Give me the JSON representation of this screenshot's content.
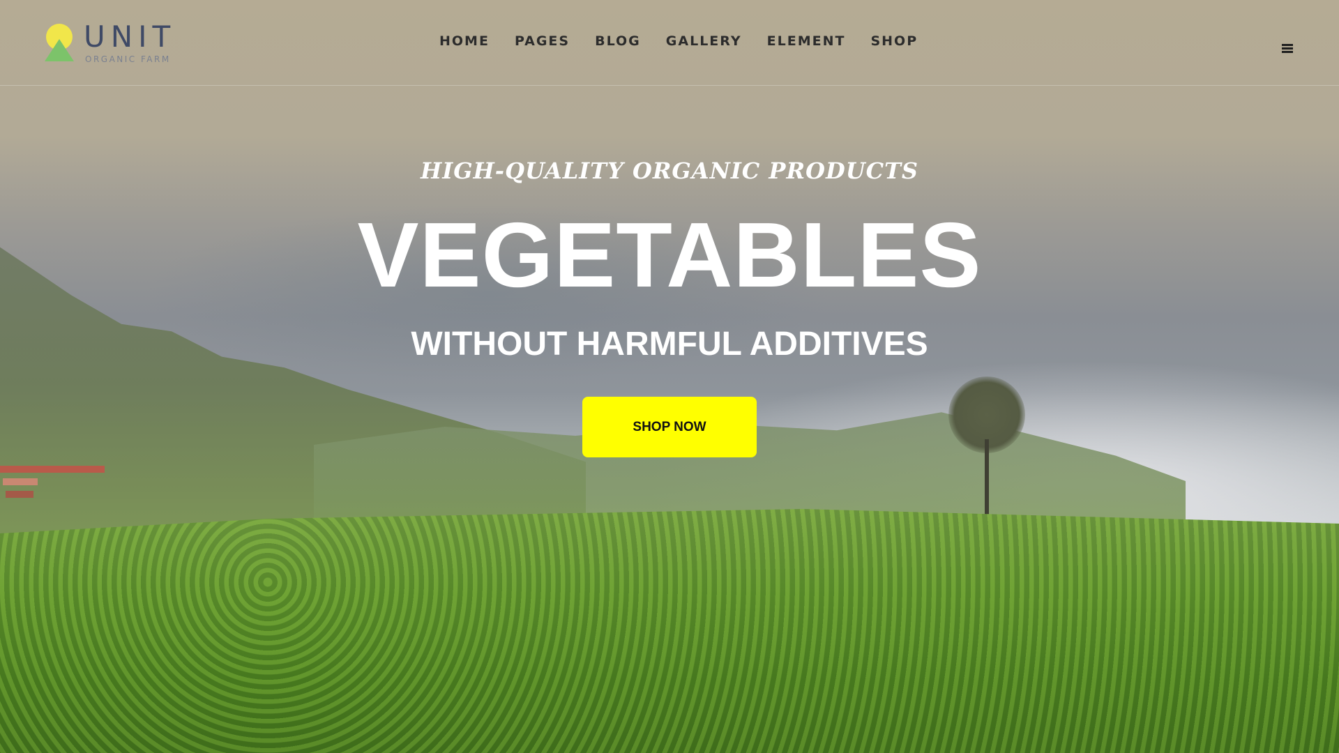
{
  "brand": {
    "name": "UNIT",
    "tagline": "ORGANIC FARM",
    "colors": {
      "sun": "#f1e64a",
      "mountain": "#7cc36a",
      "text": "#3f4a66"
    }
  },
  "nav": {
    "items": [
      {
        "label": "HOME"
      },
      {
        "label": "PAGES"
      },
      {
        "label": "BLOG"
      },
      {
        "label": "GALLERY"
      },
      {
        "label": "ELEMENT"
      },
      {
        "label": "SHOP"
      }
    ],
    "menu_icon": "hamburger-menu-icon"
  },
  "hero": {
    "kicker": "HIGH-QUALITY ORGANIC PRODUCTS",
    "title": "VEGETABLES",
    "subtitle": "WITHOUT HARMFUL ADDITIVES",
    "cta_label": "SHOP NOW",
    "cta_color": "#ffff00",
    "background": "vegetable-field-landscape"
  }
}
